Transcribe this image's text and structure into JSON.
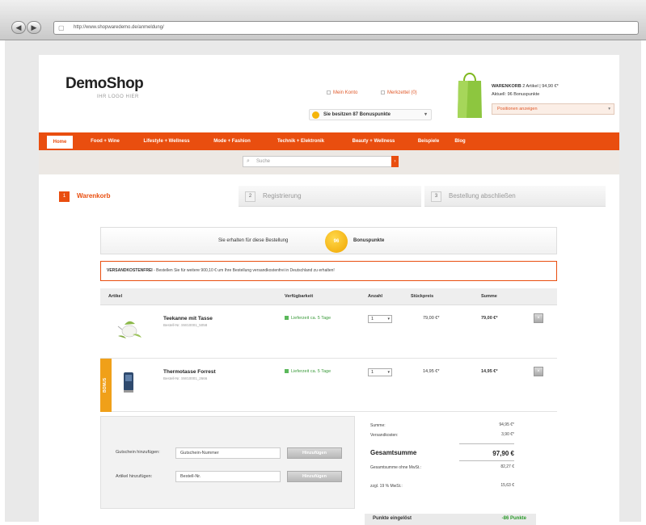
{
  "browser": {
    "url": "http://www.shopwaredemo.de/anmeldung/",
    "back_icon": "back-arrow-icon",
    "forward_icon": "forward-arrow-icon"
  },
  "shop": {
    "logo": "DemoShop",
    "logo_sub": "IHR LOGO HIER",
    "top_links": {
      "account": "Mein Konto",
      "wishlist": "Merkzettel (0)"
    },
    "bonus_select": "Sie besitzen 87 Bonuspunkte",
    "cart": {
      "title_label": "WARENKORB",
      "title_info": "2 Artikel | 94,90 €*",
      "points": "Aktuell: 96 Bonuspunkte",
      "select": "Positionen anzeigen"
    }
  },
  "nav": {
    "items": [
      "Home",
      "Food + Wine",
      "Lifestyle + Wellness",
      "Mode + Fashion",
      "Technik + Elektronik",
      "Beauty + Wellness",
      "Beispiele",
      "Blog"
    ],
    "active": "Home"
  },
  "search": {
    "placeholder": "Suche"
  },
  "steps": [
    {
      "num": "1",
      "label": "Warenkorb"
    },
    {
      "num": "2",
      "label": "Registrierung"
    },
    {
      "num": "3",
      "label": "Bestellung abschließen"
    }
  ],
  "bonus_banner": {
    "pre": "Sie erhalten für diese Bestellung",
    "points": "96",
    "post": "Bonuspunkte"
  },
  "notice": {
    "bold": "VERSANDKOSTENFREI",
    "text": " - Bestellen Sie für weitere 900,10 € um Ihre Bestellung versandkostenfrei in Deutschland zu erhalten!"
  },
  "table": {
    "headers": [
      "Artikel",
      "Verfügbarkeit",
      "Anzahl",
      "Stückpreis",
      "Summe"
    ],
    "rows": [
      {
        "name": "Teekanne mit Tasse",
        "number": "Bestell-Nr. SW10001_5058",
        "availability": "Lieferzeit ca. 5 Tage",
        "qty": "1",
        "price": "79,00 €*",
        "sum": "79,00 €*",
        "bonus": ""
      },
      {
        "name": "Thermotasse Forrest",
        "number": "Bestell-Nr. SW10001_2666",
        "availability": "Lieferzeit ca. 5 Tage",
        "qty": "1",
        "price": "14,95 €*",
        "sum": "14,95 €*",
        "bonus": "BONUS"
      }
    ]
  },
  "coupon": {
    "voucher_label": "Gutschein hinzufügen:",
    "voucher_placeholder": "Gutschein-Nummer",
    "voucher_button": "Hinzufügen",
    "article_label": "Artikel hinzufügen:",
    "article_placeholder": "Bestell-Nr.",
    "article_button": "Hinzufügen"
  },
  "totals": {
    "sum_label": "Summe:",
    "sum_value": "94,95 €*",
    "shipping_label": "Versandkosten:",
    "shipping_value": "3,90 €*",
    "grand_label": "Gesamtsumme",
    "grand_value": "97,90 €",
    "net_label": "Gesamtsumme ohne MwSt.:",
    "net_value": "82,27 €",
    "tax_label": "zzgl. 19 % MwSt.:",
    "tax_value": "15,63 €"
  },
  "points_row": {
    "label": "Punkte eingelöst",
    "value": "-86 Punkte"
  }
}
